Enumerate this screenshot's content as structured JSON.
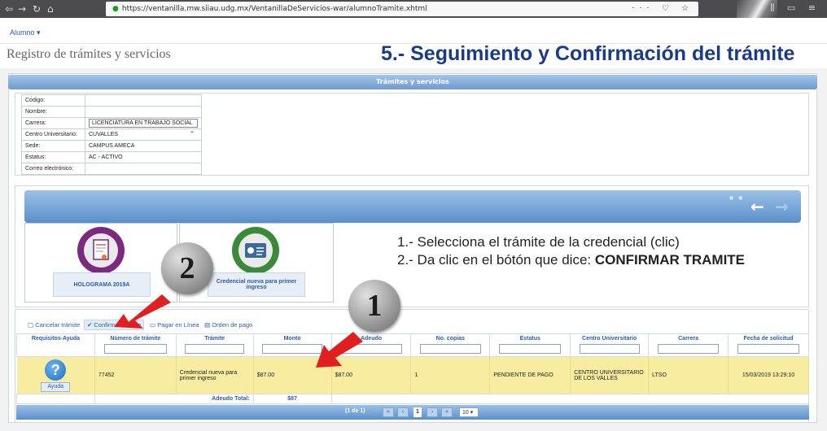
{
  "browser": {
    "url": "https://ventanilla.mw.siiau.udg.mx/VentanillaDeServicios-war/alumnoTramite.xhtml",
    "back_glyph": "⇦",
    "forward_glyph": "→",
    "reload_glyph": "↻",
    "home_glyph": "⌂",
    "url_icons": "··· ♡ ☆",
    "right_icons": "⫼ ▭ ≡"
  },
  "menu": {
    "alumno_label": "Alumno ▾"
  },
  "page_title": "Registro de trámites y servicios",
  "big_heading": "5.- Seguimiento y Confirmación del trámite",
  "panel_title": "Trámites y servicios",
  "info": {
    "rows": [
      {
        "label": "Código:",
        "value": ""
      },
      {
        "label": "Nombre:",
        "value": ""
      },
      {
        "label": "Carrera:",
        "value": "LICENCIATURA EN TRABAJO SOCIAL"
      },
      {
        "label": "Centro Universitario:",
        "value": "CUVALLES"
      },
      {
        "label": "Sede:",
        "value": "CAMPUS AMECA"
      },
      {
        "label": "Estatus:",
        "value": "AC - ACTIVO"
      },
      {
        "label": "Correo electrónico:",
        "value": ""
      }
    ]
  },
  "carousel": {
    "dots": "● ●",
    "cards": [
      {
        "label": "HOLOGRAMA 2019A",
        "color": "#7b2a7f"
      },
      {
        "label": "Credencial nueva para primer ingreso",
        "color": "#3a8a3a"
      }
    ]
  },
  "instructions": {
    "line1": "1.- Selecciona el trámite de la credencial (clic)",
    "line2_prefix": "2.- Da clic en el bótón que dice: ",
    "line2_bold": "CONFIRMAR TRAMITE"
  },
  "badges": {
    "one": "1",
    "two": "2"
  },
  "toolbar": {
    "cancel": "Cancelar trámite",
    "confirm": "Confirmar trámite",
    "pay": "Pagar en Línea",
    "order": "Orden de pago"
  },
  "grid": {
    "headers": [
      "Requisitos-Ayuda",
      "Número de trámite",
      "Trámite",
      "Monto",
      "Adeudo",
      "No. copias",
      "Estatus",
      "Centro Universitario",
      "Carrera",
      "Fecha de solicitud"
    ],
    "row": {
      "help_label": "Ayuda",
      "numero": "77452",
      "tramite": "Credencial nueva para primer ingreso",
      "monto": "$87.00",
      "adeudo": "$87.00",
      "copias": "1",
      "estatus": "PENDIENTE DE PAGO",
      "centro": "CENTRO UNIVERSITARIO DE LOS VALLES",
      "carrera": "LTSO",
      "fecha": "15/03/2019 13:29:10"
    },
    "total_label": "Adeudo Total:",
    "total_value": "$87"
  },
  "pager": {
    "count": "(1 de 1)",
    "current": "1",
    "rows": "10"
  },
  "colors": {
    "arrow": "#e02020",
    "heading": "#1a3a8a",
    "row_highlight": "#f8eca0"
  }
}
